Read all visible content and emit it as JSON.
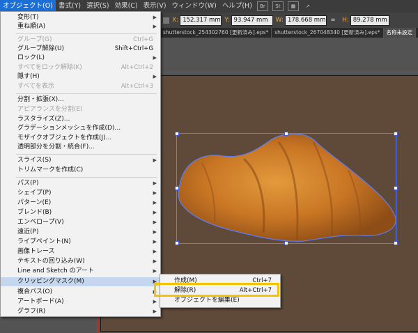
{
  "menubar": {
    "items": [
      "オブジェクト(O)",
      "書式(Y)",
      "選択(S)",
      "効果(C)",
      "表示(V)",
      "ウィンドウ(W)",
      "ヘルプ(H)"
    ],
    "tool_buttons": [
      "Br",
      "St"
    ]
  },
  "control_bar": {
    "x_label": "X:",
    "x_value": "152.317 mm",
    "y_label": "Y:",
    "y_value": "93.947 mm",
    "w_label": "W:",
    "w_value": "178.668 mm",
    "h_label": "H:",
    "h_value": "89.278 mm"
  },
  "tabs": [
    "shutterstock_254302760 [更新済み].eps*",
    "shutterstock_267048340 [更新済み].eps*",
    "名称未設定"
  ],
  "object_menu": {
    "items": [
      {
        "label": "変形(T)",
        "shortcut": "",
        "submenu": true,
        "disabled": false
      },
      {
        "label": "重ね順(A)",
        "shortcut": "",
        "submenu": true,
        "disabled": false
      },
      {
        "label": "グループ(G)",
        "shortcut": "Ctrl+G",
        "submenu": false,
        "disabled": true
      },
      {
        "label": "グループ解除(U)",
        "shortcut": "Shift+Ctrl+G",
        "submenu": false,
        "disabled": false
      },
      {
        "label": "ロック(L)",
        "shortcut": "",
        "submenu": true,
        "disabled": false
      },
      {
        "label": "すべてをロック解除(K)",
        "shortcut": "Alt+Ctrl+2",
        "submenu": false,
        "disabled": true
      },
      {
        "label": "隠す(H)",
        "shortcut": "",
        "submenu": true,
        "disabled": false
      },
      {
        "label": "すべてを表示",
        "shortcut": "Alt+Ctrl+3",
        "submenu": false,
        "disabled": true
      },
      {
        "label": "分割・拡張(X)...",
        "shortcut": "",
        "submenu": false,
        "disabled": false
      },
      {
        "label": "アピアランスを分割(E)",
        "shortcut": "",
        "submenu": false,
        "disabled": true
      },
      {
        "label": "ラスタライズ(Z)...",
        "shortcut": "",
        "submenu": false,
        "disabled": false
      },
      {
        "label": "グラデーションメッシュを作成(D)...",
        "shortcut": "",
        "submenu": false,
        "disabled": false
      },
      {
        "label": "モザイクオブジェクトを作成(J)...",
        "shortcut": "",
        "submenu": false,
        "disabled": false
      },
      {
        "label": "透明部分を分割・統合(F)...",
        "shortcut": "",
        "submenu": false,
        "disabled": false
      },
      {
        "label": "スライス(S)",
        "shortcut": "",
        "submenu": true,
        "disabled": false
      },
      {
        "label": "トリムマークを作成(C)",
        "shortcut": "",
        "submenu": false,
        "disabled": false
      },
      {
        "label": "パス(P)",
        "shortcut": "",
        "submenu": true,
        "disabled": false
      },
      {
        "label": "シェイプ(P)",
        "shortcut": "",
        "submenu": true,
        "disabled": false
      },
      {
        "label": "パターン(E)",
        "shortcut": "",
        "submenu": true,
        "disabled": false
      },
      {
        "label": "ブレンド(B)",
        "shortcut": "",
        "submenu": true,
        "disabled": false
      },
      {
        "label": "エンベロープ(V)",
        "shortcut": "",
        "submenu": true,
        "disabled": false
      },
      {
        "label": "遠近(P)",
        "shortcut": "",
        "submenu": true,
        "disabled": false
      },
      {
        "label": "ライブペイント(N)",
        "shortcut": "",
        "submenu": true,
        "disabled": false
      },
      {
        "label": "画像トレース",
        "shortcut": "",
        "submenu": true,
        "disabled": false
      },
      {
        "label": "テキストの回り込み(W)",
        "shortcut": "",
        "submenu": true,
        "disabled": false
      },
      {
        "label": "Line and Sketch のアート",
        "shortcut": "",
        "submenu": true,
        "disabled": false
      },
      {
        "label": "クリッピングマスク(M)",
        "shortcut": "",
        "submenu": true,
        "disabled": false
      },
      {
        "label": "複合パス(O)",
        "shortcut": "",
        "submenu": true,
        "disabled": false
      },
      {
        "label": "アートボード(A)",
        "shortcut": "",
        "submenu": true,
        "disabled": false
      },
      {
        "label": "グラフ(R)",
        "shortcut": "",
        "submenu": true,
        "disabled": false
      }
    ]
  },
  "clipping_submenu": {
    "items": [
      {
        "label": "作成(M)",
        "shortcut": "Ctrl+7"
      },
      {
        "label": "解除(R)",
        "shortcut": "Alt+Ctrl+7"
      },
      {
        "label": "オブジェクトを編集(E)",
        "shortcut": ""
      }
    ]
  },
  "colors": {
    "highlight_box": "#f5c400",
    "active_menu": "#1c6fd6",
    "selection": "#5a7dfb",
    "artboard_bg": "#5f4a3a"
  }
}
